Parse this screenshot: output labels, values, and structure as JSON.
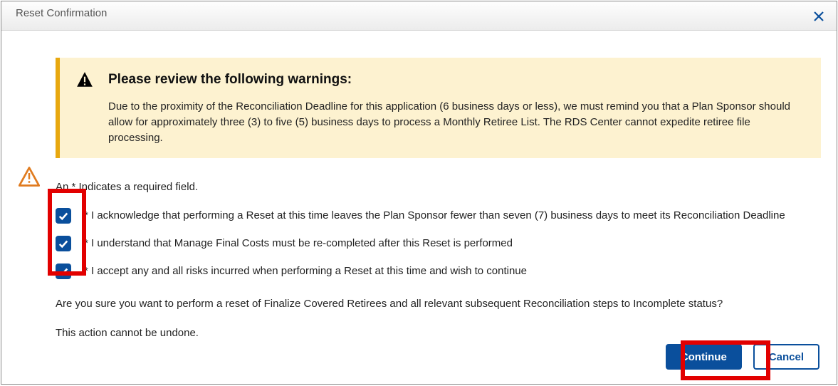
{
  "modal": {
    "title": "Reset Confirmation"
  },
  "warning": {
    "heading": "Please review the following warnings:",
    "body": "Due to the proximity of the Reconciliation Deadline for this application (6 business days or less), we must remind you that a Plan Sponsor should allow for approximately three (3) to five (5) business days to process a Monthly Retiree List. The RDS Center cannot expedite retiree file processing."
  },
  "required_note": "An * Indicates a required field.",
  "checkboxes": [
    {
      "label": "* I acknowledge that performing a Reset at this time leaves the Plan Sponsor fewer than seven (7) business days to meet its Reconciliation Deadline",
      "checked": true
    },
    {
      "label": "* I understand that Manage Final Costs must be re-completed after this Reset is performed",
      "checked": true
    },
    {
      "label": "* I accept any and all risks incurred when performing a Reset at this time and wish to continue",
      "checked": true
    }
  ],
  "confirm_question": "Are you sure you want to perform a reset of Finalize Covered Retirees and all relevant subsequent Reconciliation steps to Incomplete status?",
  "undo_note": "This action cannot be undone.",
  "buttons": {
    "continue": "Continue",
    "cancel": "Cancel"
  }
}
